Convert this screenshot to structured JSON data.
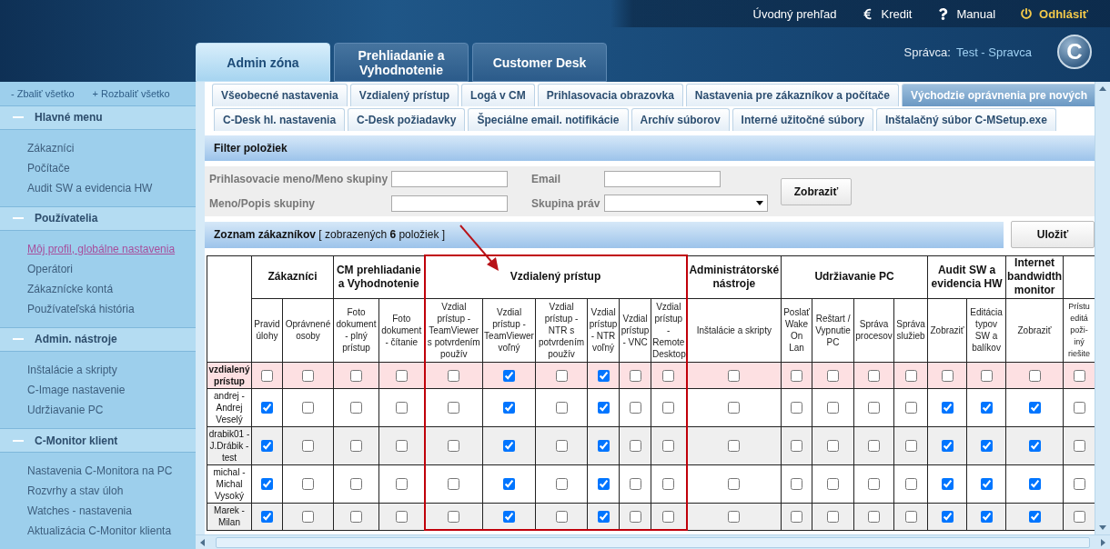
{
  "header": {
    "nav": [
      {
        "label": "Úvodný prehľad",
        "kind": "link"
      },
      {
        "label": "Kredit",
        "kind": "credit"
      },
      {
        "label": "Manual",
        "kind": "help"
      },
      {
        "label": "Odhlásiť",
        "kind": "logout"
      }
    ],
    "main_tabs": [
      {
        "label": "Admin zóna",
        "selected": true
      },
      {
        "label": "Prehliadanie a Vyhodnotenie",
        "selected": false
      },
      {
        "label": "Customer Desk",
        "selected": false
      }
    ],
    "user": {
      "label": "Správca:",
      "name": "Test - Spravca"
    },
    "logo": "C"
  },
  "sidebar": {
    "toggles": [
      "- Zbaliť všetko",
      "+ Rozbaliť všetko"
    ],
    "sections": [
      {
        "title": "Hlavné menu",
        "expanded": true,
        "items": [
          {
            "label": "Zákazníci",
            "selected": false
          },
          {
            "label": "Počítače",
            "selected": false
          },
          {
            "label": "Audit SW a evidencia HW",
            "selected": false
          }
        ]
      },
      {
        "title": "Používatelia",
        "expanded": true,
        "items": [
          {
            "label": "Môj profil, globálne nastavenia",
            "selected": true
          },
          {
            "label": "Operátori",
            "selected": false
          },
          {
            "label": "Zákaznícke kontá",
            "selected": false
          },
          {
            "label": "Používateľská história",
            "selected": false
          }
        ]
      },
      {
        "title": "Admin. nástroje",
        "expanded": true,
        "items": [
          {
            "label": "Inštalácie a skripty",
            "selected": false
          },
          {
            "label": "C-Image nastavenie",
            "selected": false
          },
          {
            "label": "Udržiavanie PC",
            "selected": false
          }
        ]
      },
      {
        "title": "C-Monitor klient",
        "expanded": true,
        "items": [
          {
            "label": "Nastavenia C-Monitora na PC",
            "selected": false
          },
          {
            "label": "Rozvrhy a stav úloh",
            "selected": false
          },
          {
            "label": "Watches - nastavenia",
            "selected": false
          },
          {
            "label": "Aktualizácia C-Monitor klienta",
            "selected": false
          }
        ]
      }
    ]
  },
  "subtabs": [
    [
      {
        "label": "Všeobecné nastavenia",
        "selected": false
      },
      {
        "label": "Vzdialený prístup",
        "selected": false
      },
      {
        "label": "Logá v CM",
        "selected": false
      },
      {
        "label": "Prihlasovacia obrazovka",
        "selected": false
      },
      {
        "label": "Nastavenia pre zákazníkov a počítače",
        "selected": false
      },
      {
        "label": "Východzie oprávnenia pre nových",
        "selected": true
      }
    ],
    [
      {
        "label": "C-Desk hl. nastavenia",
        "selected": false
      },
      {
        "label": "C-Desk požiadavky",
        "selected": false
      },
      {
        "label": "Špeciálne email. notifikácie",
        "selected": false
      },
      {
        "label": "Archív súborov",
        "selected": false
      },
      {
        "label": "Interné užitočné súbory",
        "selected": false
      },
      {
        "label": "Inštalačný súbor C-MSetup.exe",
        "selected": false
      }
    ]
  ],
  "filter": {
    "title": "Filter položiek",
    "fields": [
      {
        "label": "Prihlasovacie meno/Meno skupiny",
        "kind": "text"
      },
      {
        "label": "Email",
        "kind": "text"
      },
      {
        "label": "Meno/Popis skupiny",
        "kind": "text"
      },
      {
        "label": "Skupina práv",
        "kind": "select"
      }
    ],
    "button": "Zobraziť"
  },
  "list": {
    "title": "**Zoznam zákazníkov** [ zobrazených **6** položiek ]",
    "save_button": "Uložiť"
  },
  "table": {
    "groups": [
      {
        "title": "Zákazníci",
        "highlighted": false,
        "columns": [
          "Pravid úlohy",
          "Oprávnené osoby"
        ]
      },
      {
        "title": "CM prehliadanie a Vyhodnotenie",
        "highlighted": false,
        "columns": [
          "Foto dokument - plný prístup",
          "Foto dokument - čítanie"
        ]
      },
      {
        "title": "Vzdialený prístup",
        "highlighted": true,
        "columns": [
          "Vzdial prístup - TeamViewer s potvrdením použív",
          "Vzdial prístup - TeamViewer voľný",
          "Vzdial prístup - NTR s potvrdením použív",
          "Vzdial prístup - NTR voľný",
          "Vzdial prístup - VNC",
          "Vzdial prístup - Remote Desktop"
        ]
      },
      {
        "title": "Administrátorské nástroje",
        "highlighted": false,
        "columns": [
          "Inštalácie a skripty"
        ]
      },
      {
        "title": "Udržiavanie PC",
        "highlighted": false,
        "columns": [
          "Poslať Wake On Lan",
          "Reštart / Vypnutie PC",
          "Správa procesov",
          "Správa služieb"
        ]
      },
      {
        "title": "Audit SW a evidencia HW",
        "highlighted": false,
        "columns": [
          "Zobraziť",
          "Editácia typov SW a balíkov"
        ]
      },
      {
        "title": "Internet bandwidth monitor",
        "highlighted": false,
        "columns": [
          "Zobraziť"
        ]
      },
      {
        "highlighted": false,
        "columns": [
          "Prístu editá poži- iný riešite"
        ]
      }
    ],
    "rows": [
      {
        "label": "vzdialený prístup",
        "kind": "group",
        "checks": [
          false,
          false,
          false,
          false,
          false,
          true,
          false,
          true,
          false,
          false,
          false,
          false,
          false,
          false,
          false,
          false,
          false,
          false,
          false
        ]
      },
      {
        "label": "andrej - Andrej Veselý",
        "kind": "user",
        "checks": [
          true,
          false,
          false,
          false,
          false,
          true,
          false,
          true,
          false,
          false,
          false,
          false,
          false,
          false,
          false,
          true,
          true,
          true,
          false
        ]
      },
      {
        "label": "drabik01 - J.Drábik - test",
        "kind": "user",
        "checks": [
          true,
          false,
          false,
          false,
          false,
          true,
          false,
          true,
          false,
          false,
          false,
          false,
          false,
          false,
          false,
          true,
          true,
          true,
          false
        ]
      },
      {
        "label": "michal - Michal Vysoký",
        "kind": "user",
        "checks": [
          true,
          false,
          false,
          false,
          false,
          true,
          false,
          true,
          false,
          false,
          false,
          false,
          false,
          false,
          false,
          true,
          true,
          true,
          false
        ]
      },
      {
        "label": "Marek - Milan",
        "kind": "user",
        "checks": [
          true,
          false,
          false,
          false,
          false,
          true,
          false,
          true,
          false,
          false,
          false,
          false,
          false,
          false,
          false,
          true,
          true,
          true,
          false
        ]
      }
    ]
  }
}
